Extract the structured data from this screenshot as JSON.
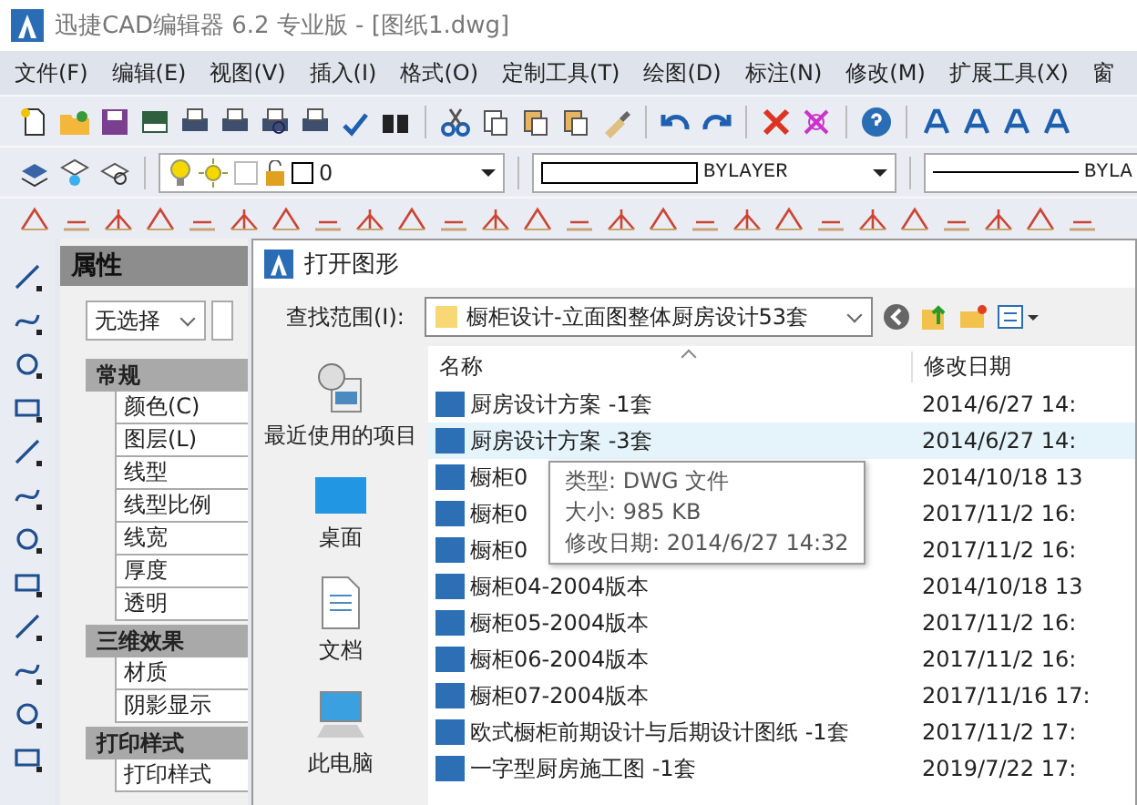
{
  "window": {
    "title": "迅捷CAD编辑器 6.2 专业版  - [图纸1.dwg]"
  },
  "menu": [
    "文件(F)",
    "编辑(E)",
    "视图(V)",
    "插入(I)",
    "格式(O)",
    "定制工具(T)",
    "绘图(D)",
    "标注(N)",
    "修改(M)",
    "扩展工具(X)",
    "窗"
  ],
  "layer_bar": {
    "layer": "0",
    "linetype": "BYLAYER",
    "lineweight": "BYLA"
  },
  "properties": {
    "title": "属性",
    "selection": "无选择",
    "sections": [
      {
        "name": "常规",
        "items": [
          "颜色(C)",
          "图层(L)",
          "线型",
          "线型比例",
          "线宽",
          "厚度",
          "透明"
        ]
      },
      {
        "name": "三维效果",
        "items": [
          "材质",
          "阴影显示"
        ]
      },
      {
        "name": "打印样式",
        "items": [
          "打印样式"
        ]
      }
    ]
  },
  "open_dialog": {
    "title": "打开图形",
    "look_in_label": "查找范围(I):",
    "folder": "橱柜设计-立面图整体厨房设计53套",
    "places": [
      "最近使用的项目",
      "桌面",
      "文档",
      "此电脑"
    ],
    "columns": [
      "名称",
      "修改日期"
    ],
    "files": [
      {
        "name": "厨房设计方案 -1套",
        "date": "2014/6/27 14:",
        "selected": false
      },
      {
        "name": "厨房设计方案 -3套",
        "date": "2014/6/27 14:",
        "selected": true
      },
      {
        "name": "橱柜0",
        "date": "2014/10/18 13",
        "selected": false
      },
      {
        "name": "橱柜0",
        "date": "2017/11/2 16:",
        "selected": false
      },
      {
        "name": "橱柜0",
        "date": "2017/11/2 16:",
        "selected": false
      },
      {
        "name": "橱柜04-2004版本",
        "date": "2014/10/18 13",
        "selected": false
      },
      {
        "name": "橱柜05-2004版本",
        "date": "2017/11/2 16:",
        "selected": false
      },
      {
        "name": "橱柜06-2004版本",
        "date": "2017/11/2 16:",
        "selected": false
      },
      {
        "name": "橱柜07-2004版本",
        "date": "2017/11/16 17:",
        "selected": false
      },
      {
        "name": "欧式橱柜前期设计与后期设计图纸 -1套",
        "date": "2017/11/2 17:",
        "selected": false
      },
      {
        "name": "一字型厨房施工图 -1套",
        "date": "2019/7/22 17:",
        "selected": false
      }
    ],
    "tooltip": [
      "类型: DWG 文件",
      "大小: 985 KB",
      "修改日期: 2014/6/27 14:32"
    ]
  }
}
